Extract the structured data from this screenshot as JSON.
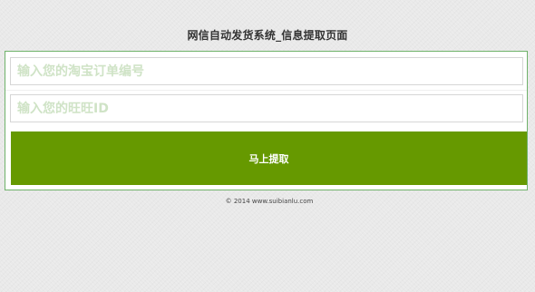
{
  "page": {
    "title": "网信自动发货系统_信息提取页面"
  },
  "form": {
    "order_field": {
      "placeholder": "输入您的淘宝订单编号",
      "value": ""
    },
    "wangwang_field": {
      "placeholder": "输入您的旺旺ID",
      "value": ""
    },
    "submit_label": "马上提取"
  },
  "footer": {
    "copyright": "© 2014 www.suibianlu.com"
  },
  "colors": {
    "accent": "#669900",
    "panel_border": "#6fb26a",
    "placeholder": "#cfe3c6",
    "background": "#e9e9e9"
  }
}
